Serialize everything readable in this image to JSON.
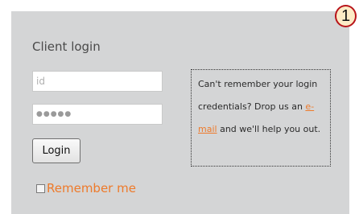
{
  "badge": {
    "number": "1"
  },
  "login_form": {
    "title": "Client login",
    "id_field": {
      "placeholder": "id",
      "value": ""
    },
    "password_field": {
      "value": "●●●●●"
    },
    "login_button_label": "Login",
    "remember_me": {
      "label": "Remember me",
      "checked": false
    }
  },
  "help": {
    "text_before": "Can't remember your login credentials? Drop us an ",
    "link_text": "e-mail",
    "text_after": " and we'll help you out."
  },
  "colors": {
    "panel_background": "#d4d5d6",
    "accent_orange": "#ee7a2a",
    "badge_border": "#b8141a",
    "badge_fill": "#fcebc6"
  }
}
